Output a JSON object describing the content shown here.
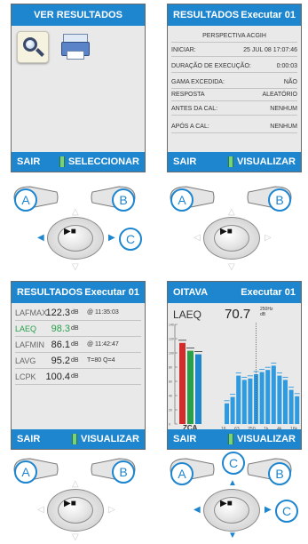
{
  "panels": {
    "ver": {
      "title": "VER RESULTADOS",
      "left_btn": "SAIR",
      "right_btn": "SELECCIONAR",
      "icons": [
        "search-icon",
        "printer-icon"
      ]
    },
    "resultados_detalhe": {
      "title": "RESULTADOS",
      "title_right": "Executar 01",
      "header_row": "PERSPECTIVA ACGIH",
      "rows": [
        {
          "label": "INICIAR:",
          "value": "25 JUL 08  17:07:46"
        },
        {
          "label": "DURAÇÃO DE EXECUÇÃO:",
          "value": "0:00:03"
        },
        {
          "label": "GAMA EXCEDIDA:",
          "value": "NÃO"
        },
        {
          "label": "RESPOSTA",
          "value": "ALEATÓRIO"
        },
        {
          "label": "ANTES DA CAL:",
          "value": "NENHUM"
        },
        {
          "label": "APÓS A CAL:",
          "value": "NENHUM"
        }
      ],
      "left_btn": "SAIR",
      "right_btn": "VISUALIZAR"
    },
    "resultados_niveis": {
      "title": "RESULTADOS",
      "title_right": "Executar 01",
      "levels": [
        {
          "label": "LAFMAX",
          "value": "122.3",
          "unit": "dB",
          "extra": "@ 11:35:03"
        },
        {
          "label": "LAEQ",
          "value": "98.3",
          "unit": "dB",
          "extra": ""
        },
        {
          "label": "LAFMIN",
          "value": "86.1",
          "unit": "dB",
          "extra": "@ 11:42:47"
        },
        {
          "label": "LAVG",
          "value": "95.2",
          "unit": "dB",
          "extra": "T=80  Q=4"
        },
        {
          "label": "LCPK",
          "value": "100.4",
          "unit": "dB",
          "extra": ""
        }
      ],
      "left_btn": "SAIR",
      "right_btn": "VISUALIZAR"
    },
    "oitava": {
      "title": "OITAVA",
      "title_right": "Executar 01",
      "laeq_label": "LAEQ",
      "big_value": "70.7",
      "big_unit_line1": "250Hz",
      "big_unit_line2": "dB",
      "zca_label": "ZCA",
      "freq_ticks": [
        "16",
        "63",
        "250",
        "1k",
        "4k",
        "16k"
      ],
      "left_btn": "SAIR",
      "right_btn": "VISUALIZAR"
    }
  },
  "controllers": {
    "a_label": "A",
    "b_label": "B",
    "c_label": "C"
  },
  "chart_data": {
    "type": "bar",
    "title": "",
    "ylim": [
      0,
      140
    ],
    "y_ticks": [
      0,
      20,
      40,
      60,
      80,
      100,
      120,
      140
    ],
    "zca_bars": [
      {
        "color": "#d32a2a",
        "value": 114
      },
      {
        "color": "#28a04a",
        "value": 103
      },
      {
        "color": "#1e86cf",
        "value": 98
      }
    ],
    "octave_values": [
      29,
      38,
      68,
      62,
      64,
      70,
      73,
      76,
      82,
      68,
      62,
      48,
      39
    ]
  },
  "colors": {
    "accent": "#1e86cf",
    "panel_bg": "#e9e9e9",
    "green": "#28a04a",
    "red": "#d32a2a"
  }
}
